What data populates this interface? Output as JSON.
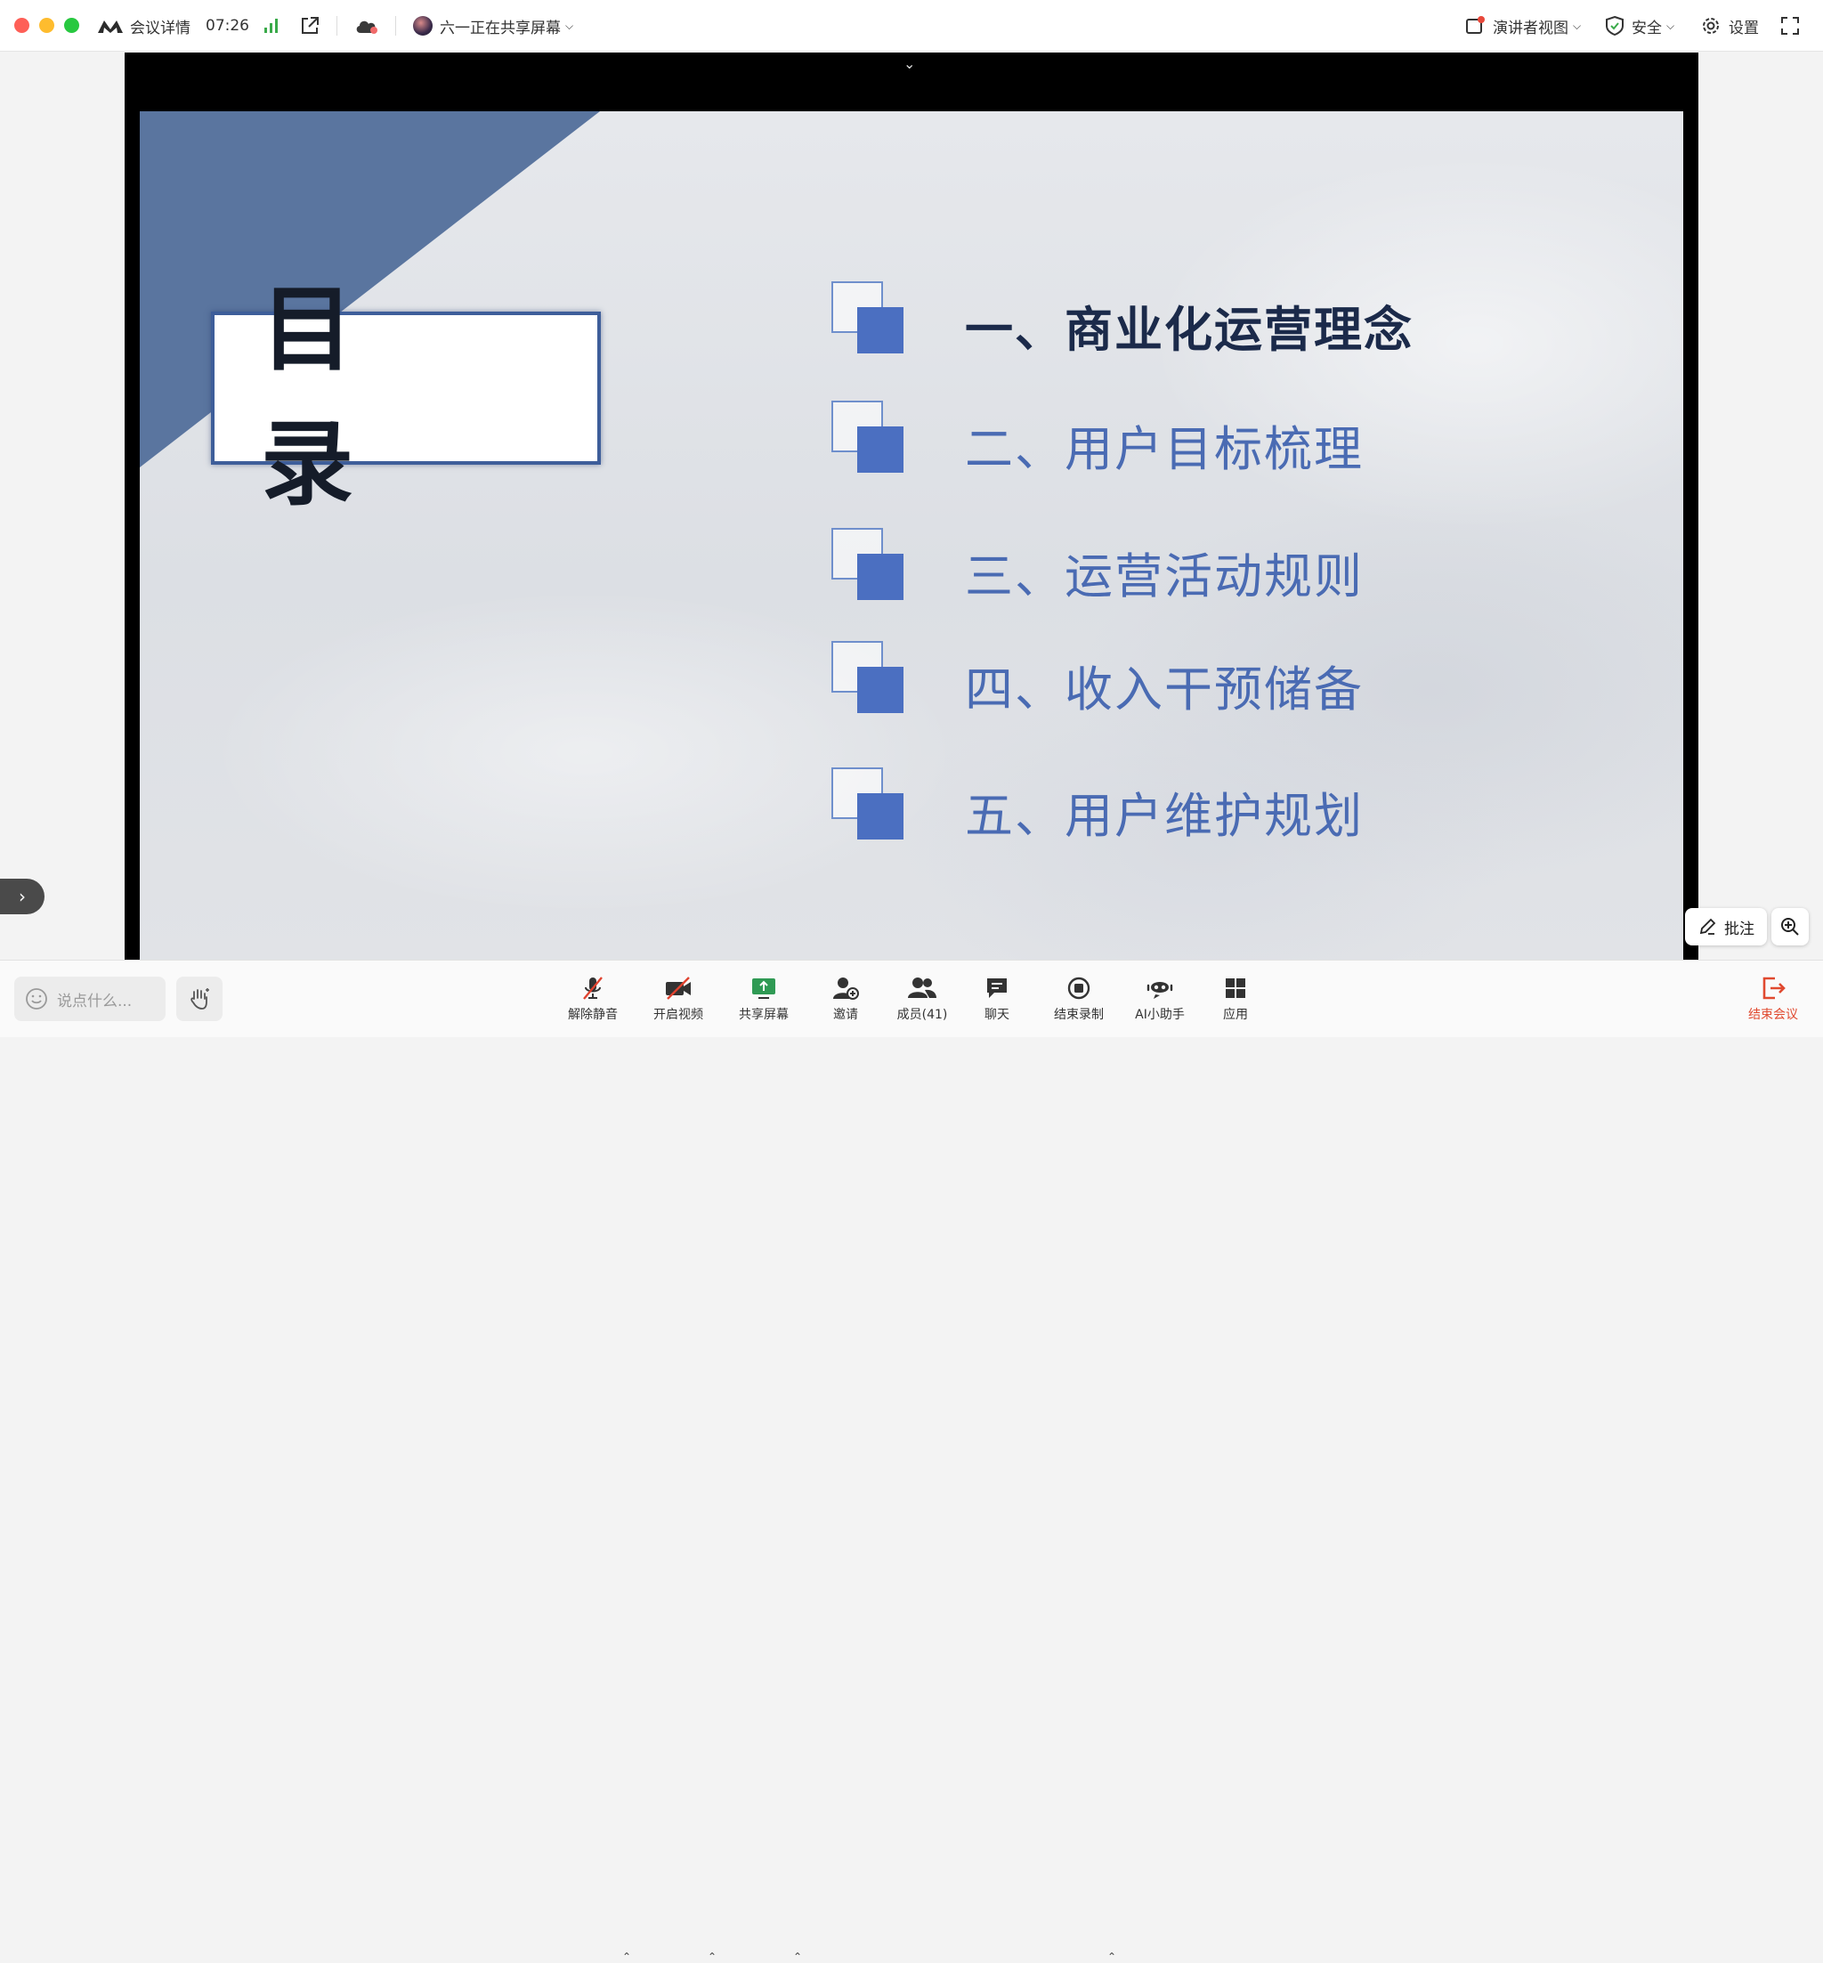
{
  "topbar": {
    "meeting_details": "会议详情",
    "timer": "07:26",
    "sharing_status": "六一正在共享屏幕",
    "presenter_view": "演讲者视图",
    "security": "安全",
    "settings": "设置"
  },
  "slide": {
    "title": "目 录",
    "items": [
      {
        "label": "一、商业化运营理念",
        "active": true
      },
      {
        "label": "二、用户目标梳理",
        "active": false
      },
      {
        "label": "三、运营活动规则",
        "active": false
      },
      {
        "label": "四、收入干预储备",
        "active": false
      },
      {
        "label": "五、用户维护规划",
        "active": false
      }
    ],
    "colors": {
      "triangle": "#5a759f",
      "square_fill": "#4b6fc1",
      "active_text": "#1b2a4a",
      "text": "#4a6bb3"
    }
  },
  "annotate": {
    "label": "批注"
  },
  "bottombar": {
    "chat_placeholder": "说点什么...",
    "unmute": "解除静音",
    "start_video": "开启视频",
    "share_screen": "共享屏幕",
    "invite": "邀请",
    "members": "成员(41)",
    "chat": "聊天",
    "end_recording": "结束录制",
    "ai_assistant": "AI小助手",
    "apps": "应用",
    "end_meeting": "结束会议"
  },
  "icons": [
    "meeting-logo-icon",
    "signal-icon",
    "external-link-icon",
    "cloud-icon",
    "avatar-icon",
    "presenter-view-icon",
    "shield-icon",
    "gear-icon",
    "fullscreen-icon",
    "mic-muted-icon",
    "video-off-icon",
    "share-screen-icon",
    "invite-icon",
    "members-icon",
    "chat-icon",
    "record-stop-icon",
    "ai-assistant-icon",
    "apps-icon",
    "exit-icon",
    "hand-icon",
    "smile-icon",
    "pen-icon",
    "zoom-in-icon"
  ]
}
